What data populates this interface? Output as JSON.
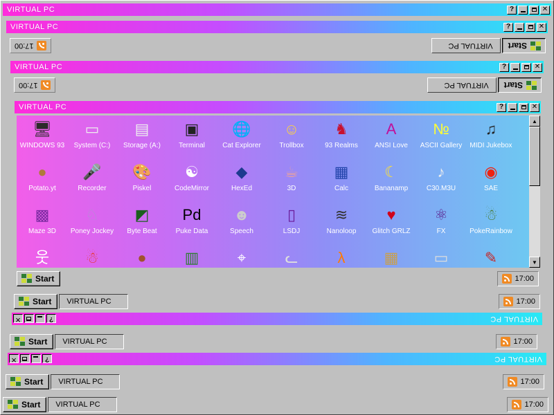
{
  "window_title": "VIRTUAL PC",
  "start_label": "Start",
  "task_label": "VIRTUAL PC",
  "clock": "17:00",
  "title_buttons": {
    "help": "?"
  },
  "icons": [
    {
      "label": "WINDOWS 93",
      "icon": "computer-icon"
    },
    {
      "label": "System (C:)",
      "icon": "drive-icon"
    },
    {
      "label": "Storage (A:)",
      "icon": "floppy-drive-icon"
    },
    {
      "label": "Terminal",
      "icon": "terminal-icon"
    },
    {
      "label": "Cat Explorer",
      "icon": "globe-cat-icon"
    },
    {
      "label": "Trollbox",
      "icon": "chat-face-icon"
    },
    {
      "label": "93 Realms",
      "icon": "dragon-icon"
    },
    {
      "label": "ANSI Love",
      "icon": "ansi-book-icon"
    },
    {
      "label": "ASCII Gallery",
      "icon": "numbers-icon"
    },
    {
      "label": "MIDI Jukebox",
      "icon": "piano-icon"
    },
    {
      "label": "Potato.yt",
      "icon": "potato-icon"
    },
    {
      "label": "Recorder",
      "icon": "microphone-icon"
    },
    {
      "label": "Piskel",
      "icon": "palette-icon"
    },
    {
      "label": "CodeMirror",
      "icon": "codemirror-icon"
    },
    {
      "label": "HexEd",
      "icon": "cube-icon"
    },
    {
      "label": "3D",
      "icon": "teapot-icon"
    },
    {
      "label": "Calc",
      "icon": "calculator-icon"
    },
    {
      "label": "Bananamp",
      "icon": "banana-icon"
    },
    {
      "label": "C30.M3U",
      "icon": "speaker-file-icon"
    },
    {
      "label": "SAE",
      "icon": "amiga-ball-icon"
    },
    {
      "label": "Maze 3D",
      "icon": "maze-icon"
    },
    {
      "label": "Poney Jockey",
      "icon": "pony-icon"
    },
    {
      "label": "Byte Beat",
      "icon": "bytebeat-icon"
    },
    {
      "label": "Puke Data",
      "icon": "puredata-icon"
    },
    {
      "label": "Speech",
      "icon": "face-icon"
    },
    {
      "label": "LSDJ",
      "icon": "gameboy-icon"
    },
    {
      "label": "Nanoloop",
      "icon": "wave-icon"
    },
    {
      "label": "Glitch GRLZ",
      "icon": "lips-icon"
    },
    {
      "label": "FX",
      "icon": "atom-icon"
    },
    {
      "label": "PokeRainbow",
      "icon": "trainers-icon"
    },
    {
      "label": "",
      "icon": "stickman-icon"
    },
    {
      "label": "",
      "icon": "santa-icon"
    },
    {
      "label": "",
      "icon": "cookie-icon"
    },
    {
      "label": "",
      "icon": "terminal-green-icon"
    },
    {
      "label": "",
      "icon": "window-cursor-icon"
    },
    {
      "label": "",
      "icon": "cat-icon"
    },
    {
      "label": "",
      "icon": "half-life-icon"
    },
    {
      "label": "",
      "icon": "dosbox-icon"
    },
    {
      "label": "",
      "icon": "nes-icon"
    },
    {
      "label": "",
      "icon": "document-icon"
    }
  ],
  "colors": {
    "title_pink": "#ff2bdc",
    "title_cyan": "#27eaf5",
    "face": "#c0c0c0",
    "rss": "#f08a24"
  }
}
